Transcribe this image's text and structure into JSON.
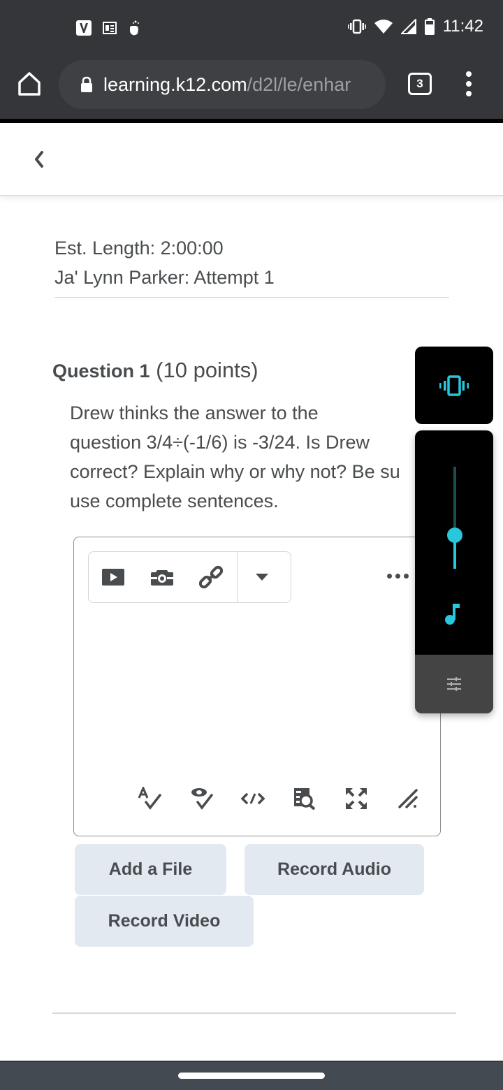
{
  "status_bar": {
    "time": "11:42",
    "left_icons": [
      "vpn-v-icon",
      "news-icon",
      "hand-sparkle-icon"
    ],
    "right_icons": [
      "vibrate-icon",
      "wifi-icon",
      "signal-icon",
      "battery-icon"
    ]
  },
  "browser": {
    "url_host": "learning.k12.com",
    "url_path": "/d2l/le/enhar",
    "tab_count": "3"
  },
  "quiz": {
    "est_length": "Est. Length: 2:00:00",
    "attempt": "Ja' Lynn Parker: Attempt 1",
    "question_label": "Question 1",
    "question_points": "(10 points)",
    "question_text": "Drew thinks the answer to the\nquestion 3/4÷(-1/6) is -3/24. Is Drew\ncorrect? Explain why or why not? Be su\nuse complete sentences."
  },
  "editor": {
    "toolbar": [
      "insert-video",
      "insert-image",
      "insert-link",
      "more-insert-dropdown"
    ],
    "bottom_tools": [
      "spellcheck",
      "accessibility-check",
      "source-code",
      "preview",
      "fullscreen",
      "resize"
    ],
    "value": ""
  },
  "buttons": {
    "add_file": "Add a File",
    "record_audio": "Record Audio",
    "record_video": "Record Video"
  },
  "volume_panel": {
    "mode": "vibrate",
    "media_volume_level": 0.33,
    "accent_color": "#28c8dc"
  }
}
